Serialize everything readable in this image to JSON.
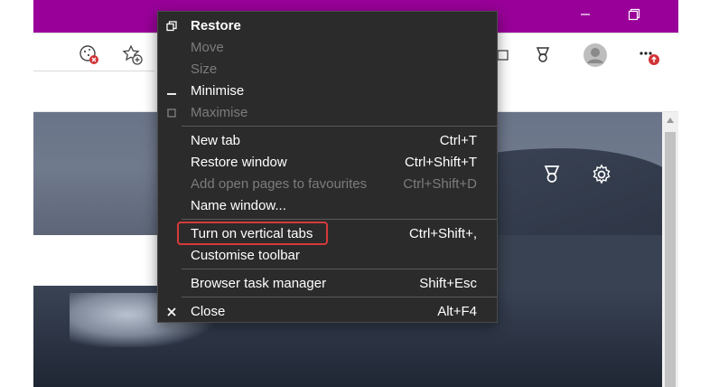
{
  "window_controls": {
    "minimize_icon": "minimize-icon",
    "maximize_icon": "restore-window-icon",
    "close_icon": "close-icon"
  },
  "toolbar": {
    "icons": [
      "cookie-blocked-icon",
      "add-favorite-icon",
      "collections-icon",
      "rewards-trophy-icon",
      "profile-avatar-icon",
      "more-menu-icon"
    ],
    "notification_badge": "↑"
  },
  "context_menu": {
    "items": [
      {
        "label": "Restore",
        "shortcut": "",
        "enabled": true,
        "bold": true,
        "icon": "restore-icon"
      },
      {
        "label": "Move",
        "shortcut": "",
        "enabled": false
      },
      {
        "label": "Size",
        "shortcut": "",
        "enabled": false
      },
      {
        "label": "Minimise",
        "shortcut": "",
        "enabled": true,
        "icon": "minimise-icon"
      },
      {
        "label": "Maximise",
        "shortcut": "",
        "enabled": false,
        "icon": "maximise-icon"
      },
      {
        "label": "New tab",
        "shortcut": "Ctrl+T",
        "enabled": true
      },
      {
        "label": "Restore window",
        "shortcut": "Ctrl+Shift+T",
        "enabled": true
      },
      {
        "label": "Add open pages to favourites",
        "shortcut": "Ctrl+Shift+D",
        "enabled": false
      },
      {
        "label": "Name window...",
        "shortcut": "",
        "enabled": true
      },
      {
        "label": "Turn on vertical tabs",
        "shortcut": "Ctrl+Shift+,",
        "enabled": true,
        "highlighted": true
      },
      {
        "label": "Customise toolbar",
        "shortcut": "",
        "enabled": true
      },
      {
        "label": "Browser task manager",
        "shortcut": "Shift+Esc",
        "enabled": true
      },
      {
        "label": "Close",
        "shortcut": "Alt+F4",
        "enabled": true,
        "icon": "close-x-icon"
      }
    ],
    "highlight_color": "#d63a3a"
  },
  "page": {
    "icons": [
      "rewards-trophy-icon",
      "settings-gear-icon"
    ]
  },
  "colors": {
    "titlebar": "#990099",
    "menu_background": "#2b2b2b",
    "menu_text": "#ffffff",
    "menu_disabled_text": "#7c7c7c"
  }
}
